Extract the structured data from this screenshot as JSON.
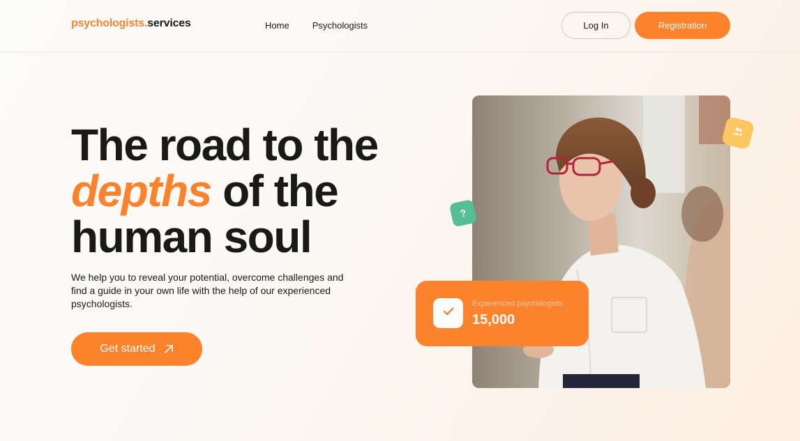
{
  "header": {
    "logo": {
      "part1": "psychologists",
      "dot": ".",
      "part2": "services"
    },
    "nav": [
      "Home",
      "Psychologists"
    ],
    "login_label": "Log In",
    "register_label": "Registration"
  },
  "hero": {
    "title_line1": "The road to the",
    "title_em": "depths",
    "title_line2_rest": " of the",
    "title_line3": "human soul",
    "subtitle": "We help you to reveal your potential, overcome challenges and find a guide in your own life with the help of our experienced psychologists.",
    "cta_label": "Get started"
  },
  "stats": {
    "label": "Experienced psychologists",
    "value": "15,000"
  },
  "badges": {
    "question_glyph": "?"
  },
  "icons": [
    "arrow-up-right-icon",
    "question-icon",
    "users-icon",
    "check-icon"
  ],
  "colors": {
    "accent": "#fc832c",
    "text": "#191a15",
    "green": "#54be96",
    "yellow": "#fbc75e"
  }
}
